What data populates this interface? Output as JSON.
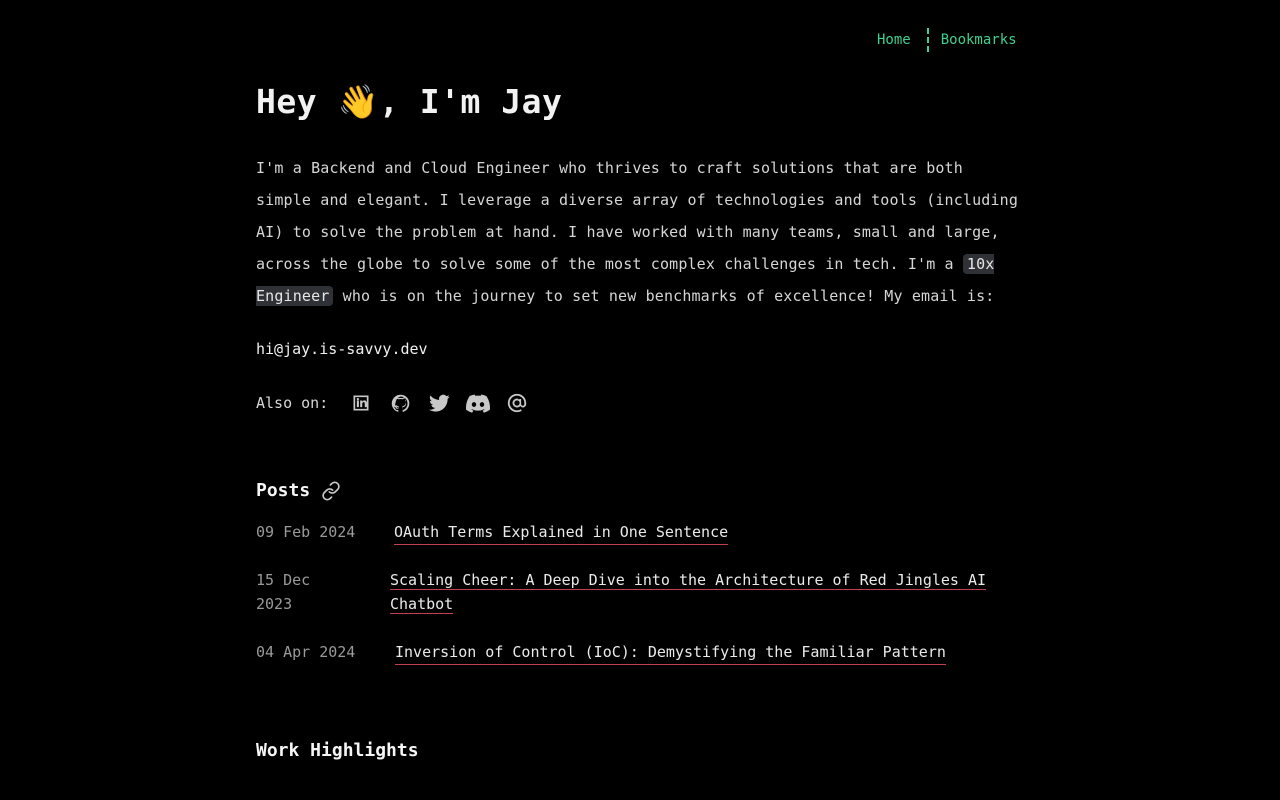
{
  "nav": {
    "home": "Home",
    "bookmarks": "Bookmarks"
  },
  "hero": {
    "title": "Hey 👋, I'm Jay"
  },
  "intro": {
    "part1": "I'm a Backend and Cloud Engineer who thrives to craft solutions that are both simple and elegant. I leverage a diverse array of technologies and tools (including AI) to solve the problem at hand. I have worked with many teams, small and large, across the globe to solve some of the most complex challenges in tech. I'm a ",
    "highlight": "10x Engineer",
    "part2": " who is on the journey to set new benchmarks of excellence! My email is:"
  },
  "contact": {
    "email": "hi@jay.is-savvy.dev",
    "also_label": "Also on:",
    "social": [
      "linkedin-icon",
      "github-icon",
      "twitter-icon",
      "discord-icon",
      "at-sign-icon"
    ]
  },
  "posts": {
    "heading": "Posts",
    "items": [
      {
        "date": "09 Feb 2024",
        "title": "OAuth Terms Explained in One Sentence"
      },
      {
        "date": "15 Dec 2023",
        "title": "Scaling Cheer: A Deep Dive into the Architecture of Red Jingles AI Chatbot"
      },
      {
        "date": "04 Apr 2024",
        "title": "Inversion of Control (IoC): Demystifying the Familiar Pattern"
      }
    ]
  },
  "work": {
    "heading": "Work Highlights"
  },
  "colors": {
    "accent": "#3fcf8e",
    "link_underline": "#c2414b",
    "background": "#000000"
  }
}
